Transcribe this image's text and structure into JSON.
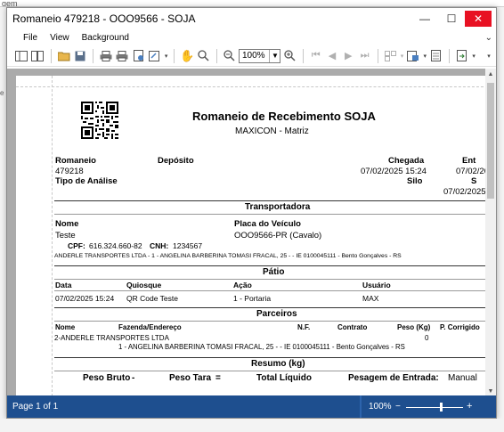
{
  "window": {
    "title": "Romaneio 479218 - OOO9566 - SOJA",
    "minimize_glyph": "—",
    "maximize_glyph": "☐",
    "close_glyph": "✕",
    "background_fragment": "gem"
  },
  "menu": {
    "items": [
      "File",
      "View",
      "Background"
    ],
    "overflow_glyph": "⌄"
  },
  "toolbar": {
    "zoom_value": "100%",
    "icons": [
      "outline-icon",
      "thumbnails-icon",
      "open-icon",
      "save-icon",
      "print-icon",
      "quick-print-icon",
      "page-setup-icon",
      "scale-icon",
      "hand-tool-icon",
      "magnifier-icon",
      "zoom-out-icon",
      "zoom-in-icon",
      "first-page-icon",
      "previous-page-icon",
      "next-page-icon",
      "last-page-icon",
      "multiple-pages-icon",
      "background-color-icon",
      "watermark-icon",
      "export-icon"
    ]
  },
  "report": {
    "title": "Romaneio de Recebimento SOJA",
    "subtitle": "MAXICON - Matriz",
    "romaneio_label": "Romaneio",
    "romaneio_value": "479218",
    "tipo_analise_label": "Tipo de Análise",
    "deposito_label": "Depósito",
    "chegada_label": "Chegada",
    "chegada_value": "07/02/2025 15:24",
    "silo_label": "Silo",
    "entrada_label": "Ent",
    "entrada_value": "07/02/20",
    "col_s_label": "S",
    "col_s_value": "07/02/2025",
    "transportadora": {
      "header": "Transportadora",
      "nome_label": "Nome",
      "nome_value": "Teste",
      "placa_label": "Placa do Veículo",
      "placa_value": "OOO9566-PR (Cavalo)",
      "cpf_label": "CPF:",
      "cpf_value": "616.324.660-82",
      "cnh_label": "CNH:",
      "cnh_value": "1234567",
      "address": "ANDERLE TRANSPORTES LTDA - 1 - ANGELINA BARBERINA TOMASI FRACAL, 25 -   - IE 0100045111 - Bento Gonçalves - RS"
    },
    "patio": {
      "header": "Pátio",
      "columns": [
        "Data",
        "Quiosque",
        "Ação",
        "Usuário"
      ],
      "row": [
        "07/02/2025 15:24",
        "QR Code Teste",
        "1 - Portaria",
        "MAX"
      ]
    },
    "parceiros": {
      "header": "Parceiros",
      "columns": [
        "Nome",
        "Fazenda/Endereço",
        "N.F.",
        "Contrato",
        "Peso (Kg)",
        "P. Corrigido"
      ],
      "row_name": "2-ANDERLE TRANSPORTES LTDA",
      "row_peso": "0",
      "row_address": "1 - ANGELINA BARBERINA TOMASI FRACAL, 25 -   - IE 0100045111 - Bento Gonçalves - RS"
    },
    "resumo": {
      "header": "Resumo (kg)",
      "peso_bruto": "Peso Bruto",
      "minus": "-",
      "peso_tara": "Peso Tara",
      "equals": "=",
      "total_liquido": "Total Líquido",
      "pesagem_entrada": "Pesagem de Entrada:",
      "manual": "Manual"
    }
  },
  "status": {
    "page": "Page 1 of 1",
    "zoom": "100%",
    "zoom_minus": "−",
    "zoom_plus": "+"
  },
  "colors": {
    "statusbar": "#1e4f8f",
    "close_button": "#e81123",
    "viewer_background": "#ababab"
  }
}
